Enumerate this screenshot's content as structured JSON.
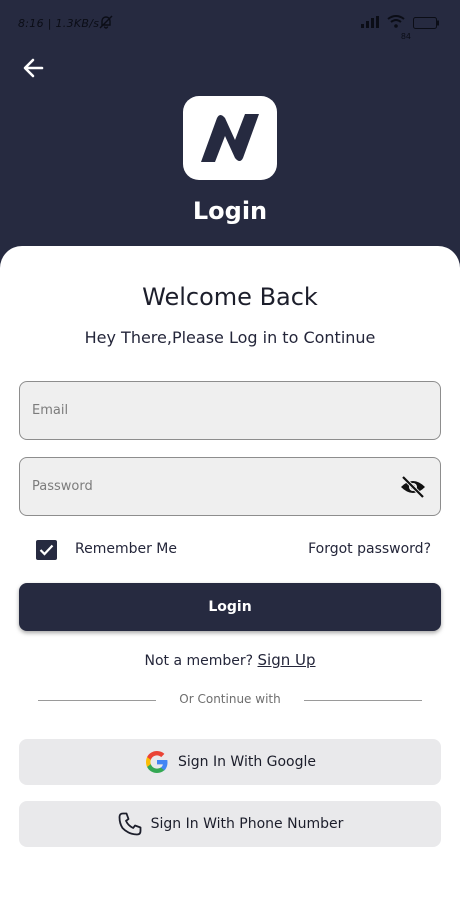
{
  "status_bar": {
    "time_speed": "8:16 | 1.3KB/s",
    "battery": "84"
  },
  "header": {
    "title": "Login"
  },
  "main": {
    "welcome": "Welcome Back",
    "subtitle": "Hey There,Please Log in to Continue",
    "email_placeholder": "Email",
    "password_placeholder": "Password",
    "remember_label": "Remember Me",
    "remember_checked": true,
    "forgot_label": "Forgot password?",
    "login_label": "Login",
    "member_text": "Not a member?",
    "signup_label": "Sign Up",
    "or_text": "Or Continue with",
    "google_label": "Sign In With Google",
    "phone_label": "Sign In With Phone Number"
  },
  "colors": {
    "primary": "#262a40",
    "field_bg": "#efefef",
    "social_bg": "#e9e9eb"
  }
}
